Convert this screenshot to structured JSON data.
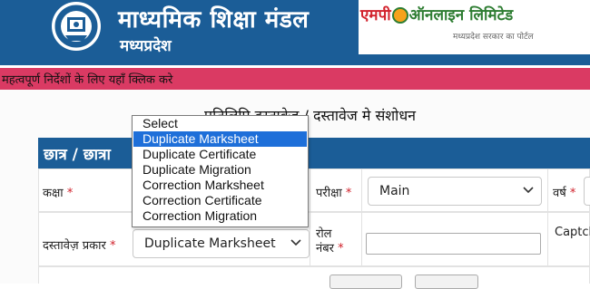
{
  "header": {
    "board_title": "माध्यमिक शिक्षा मंडल",
    "board_subtitle": "मध्यप्रदेश",
    "partner_part1": "एमपी",
    "partner_part2": "ऑनलाइन लिमिटेड",
    "partner_tagline": "मध्यप्रदेश सरकार का पोर्टल"
  },
  "notice_banner": {
    "text": "महत्वपूर्ण निर्देशों के लिए यहाँ क्लिक करे"
  },
  "page": {
    "title": "प्रतिलिपि दस्तावेज़ / दस्तावेज मे संशोधन"
  },
  "section": {
    "title": "छात्र / छात्रा"
  },
  "form": {
    "class_label": "कक्षा",
    "exam_label": "परीक्षा",
    "exam_value": "Main",
    "year_label": "वर्ष",
    "doc_type_label": "दस्तावेज़ प्रकार",
    "doc_type_value": "Duplicate Marksheet",
    "roll_label_line1": "रोल",
    "roll_label_line2": "नंबर",
    "roll_value": "",
    "captcha_label": "Captch",
    "required_mark": "*"
  },
  "dropdown": {
    "options": [
      "Select",
      "Duplicate Marksheet",
      "Duplicate Certificate",
      "Duplicate Migration",
      "Correction Marksheet",
      "Correction Certificate",
      "Correction Migration"
    ],
    "selected": "Duplicate Marksheet"
  },
  "colors": {
    "header_blue": "#1b5d97",
    "banner_pink": "#da3a63",
    "highlight_blue": "#1e6fd9",
    "required_red": "#d0202a"
  }
}
